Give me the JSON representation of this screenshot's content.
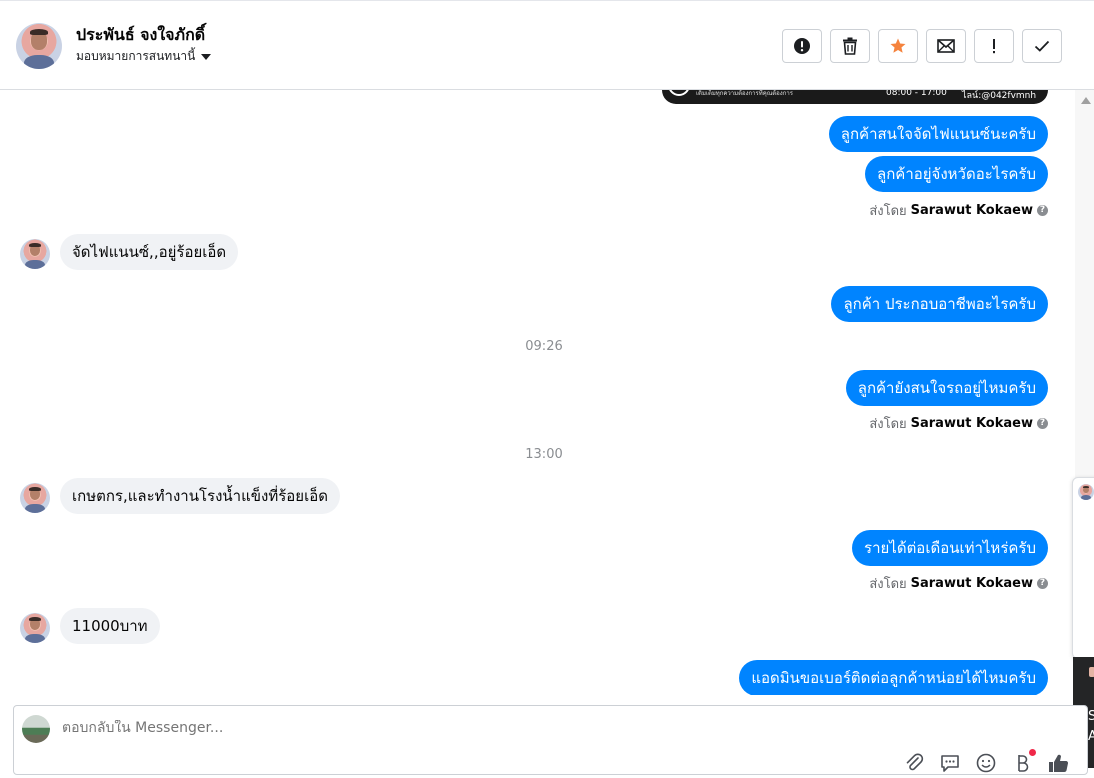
{
  "header": {
    "contact_name": "ประพันธ์ จงใจภักดิ์",
    "assign_label": "มอบหมายการสนทนานี้",
    "toolbar_icons": [
      "alert-circle-icon",
      "trash-icon",
      "star-icon",
      "envelope-icon",
      "exclamation-icon",
      "check-icon"
    ]
  },
  "top_image": {
    "caption_left": "เติมเต็มทุกความต้องการที่คุณต้องการ",
    "hours": "08:00 - 17:00",
    "line_id": "ไลน์:@042fvmnh"
  },
  "messages": {
    "out_1": "ลูกค้าสนใจจัดไฟแนนซ์นะครับ",
    "out_2": "ลูกค้าอยู่จังหวัดอะไรครับ",
    "sent_by_1": {
      "prefix": "ส่งโดย",
      "name": "Sarawut Kokaew"
    },
    "in_1": "จัดไฟแนนซ์,,อยู่ร้อยเอ็ด",
    "out_3": "ลูกค้า ประกอบอาชีพอะไรครับ",
    "time_1": "09:26",
    "out_4": "ลูกค้ายังสนใจรถอยู่ไหมครับ",
    "sent_by_2": {
      "prefix": "ส่งโดย",
      "name": "Sarawut Kokaew"
    },
    "time_2": "13:00",
    "in_2": "เกษตกร,และทำงานโรงน้ำแข็งที่ร้อยเอ็ด",
    "out_5": "รายได้ต่อเดือนเท่าไหร่ครับ",
    "sent_by_3": {
      "prefix": "ส่งโดย",
      "name": "Sarawut Kokaew"
    },
    "in_3": "11000บาท",
    "out_6": "แอดมินขอเบอร์ติดต่อลูกค้าหน่อยได้ไหมครับ"
  },
  "side_panel": {
    "text_1": "S",
    "text_2": "A"
  },
  "composer": {
    "placeholder": "ตอบกลับใน Messenger...",
    "tools": [
      "paperclip-icon",
      "saved-reply-icon",
      "emoji-icon",
      "payment-icon",
      "like-icon"
    ]
  },
  "colors": {
    "accent": "#0084ff",
    "incoming_bubble": "#f0f2f5",
    "star": "#f5833d"
  }
}
